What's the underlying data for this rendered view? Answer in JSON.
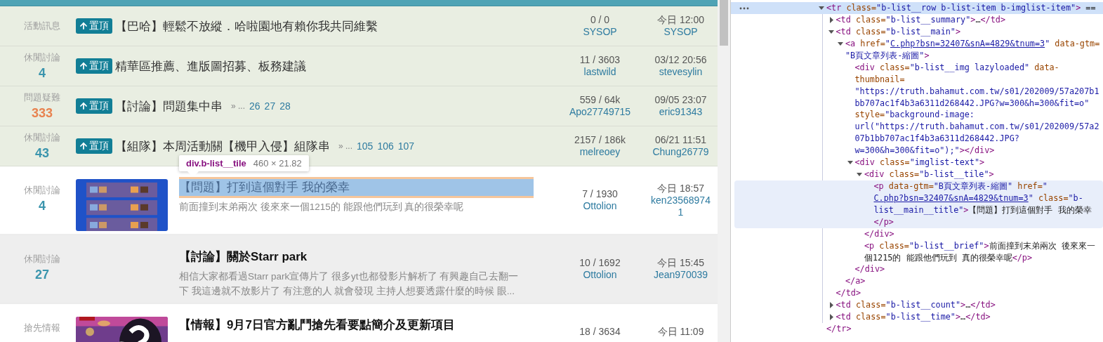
{
  "forum": {
    "rows": [
      {
        "kind": "pinned",
        "category": "活動訊息",
        "badge": "置頂",
        "title": "【巴哈】輕鬆不放縱．哈啦園地有賴你我共同維繫",
        "replies": "0 / 0",
        "author": "SYSOP",
        "time": "今日 12:00",
        "last_author": "SYSOP"
      },
      {
        "kind": "pinned",
        "category": "休閒討論",
        "count": "4",
        "color": "#3b95ad",
        "badge": "置頂",
        "title": "精華區推薦、進版圖招募、板務建議",
        "replies": "11 / 3603",
        "author": "lastwild",
        "time": "03/12 20:56",
        "last_author": "stevesylin"
      },
      {
        "kind": "pinned",
        "category": "問題疑難",
        "count": "333",
        "color": "#e8824f",
        "badge": "置頂",
        "title": "【討論】問題集中串",
        "page_prefix": "» ...",
        "pages": [
          "26",
          "27",
          "28"
        ],
        "replies": "559 / 64k",
        "author": "Apo27749715",
        "time": "09/05 23:07",
        "last_author": "eric91343"
      },
      {
        "kind": "pinned",
        "category": "休閒討論",
        "count": "43",
        "color": "#3b95ad",
        "badge": "置頂",
        "title": "【組隊】本周活動關【機甲入侵】組隊串",
        "page_prefix": "» ...",
        "pages": [
          "105",
          "106",
          "107"
        ],
        "replies": "2157 / 186k",
        "author": "melreoey",
        "time": "06/21 11:51",
        "last_author": "Chung26779"
      },
      {
        "kind": "normal",
        "shaded": false,
        "category": "休閒討論",
        "count": "4",
        "color": "#3b95ad",
        "thumbnail": {
          "kind": "picture",
          "video": false
        },
        "title": "【問題】打到這個對手 我的榮幸",
        "inspected": true,
        "inspect_tooltip": {
          "selector": "div.b-list__tile",
          "size": "460 × 21.82"
        },
        "brief": "前面撞到末弟兩次 後來來一個1215的 能跟他們玩到 真的很榮幸呢",
        "replies": "7 / 1930",
        "author": "Ottolion",
        "time": "今日 18:57",
        "last_author": "ken235689741"
      },
      {
        "kind": "normal",
        "shaded": true,
        "category": "休閒討論",
        "count": "27",
        "color": "#3b95ad",
        "title": "【討論】關於Starr park",
        "inspected": false,
        "brief": "相信大家都看過Starr park宣傳片了 很多yt也都發影片解析了 有興趣自己去翻一下 我這邊就不放影片了 有注意的人 就會發現 主持人想要透露什麼的時候 眼...",
        "replies": "10 / 1692",
        "author": "Ottolion",
        "time": "今日 15:45",
        "last_author": "Jean970039"
      },
      {
        "kind": "normal",
        "shaded": false,
        "category": "搶先情報",
        "thumbnail": {
          "kind": "picture",
          "video": true
        },
        "title": "【情報】9月7日官方亂鬥搶先看要點簡介及更新項目",
        "inspected": false,
        "replies": "18 / 3634",
        "time": "今日 11:09"
      }
    ]
  },
  "devtools": {
    "nodes": [
      {
        "selected": true,
        "hovered": false,
        "expanded": true,
        "open": [
          {
            "tag": "<tr"
          },
          {
            "attr": " class="
          },
          {
            "val": "\"b-list__row b-list-item b-imglist-item\""
          },
          {
            "tag": ">"
          },
          {
            "text": " =="
          }
        ],
        "close": [
          {
            "tag": "</tr>"
          }
        ],
        "children": [
          {
            "selected": false,
            "hovered": false,
            "expanded": false,
            "open": [
              {
                "tag": "<td"
              },
              {
                "attr": " class="
              },
              {
                "val": "\"b-list__summary\""
              },
              {
                "tag": ">"
              },
              {
                "text": "…"
              },
              {
                "tag": "</td>"
              }
            ]
          },
          {
            "selected": false,
            "hovered": false,
            "expanded": true,
            "open": [
              {
                "tag": "<td"
              },
              {
                "attr": " class="
              },
              {
                "val": "\"b-list__main\""
              },
              {
                "tag": ">"
              }
            ],
            "close": [
              {
                "tag": "</td>"
              }
            ],
            "children": [
              {
                "selected": false,
                "hovered": false,
                "expanded": true,
                "open": [
                  {
                    "tag": "<a"
                  },
                  {
                    "attr": " href="
                  },
                  {
                    "val": "\""
                  },
                  {
                    "link": "C.php?bsn=32407&snA=4829&tnum=3"
                  },
                  {
                    "val": "\""
                  },
                  {
                    "attr": " data-gtm="
                  },
                  {
                    "val": "\"B頁文章列表-縮圖\""
                  },
                  {
                    "tag": ">"
                  }
                ],
                "close": [
                  {
                    "tag": "</a>"
                  }
                ],
                "children": [
                  {
                    "selected": false,
                    "hovered": false,
                    "open": [
                      {
                        "tag": "<div"
                      },
                      {
                        "attr": " class="
                      },
                      {
                        "val": "\"b-list__img lazyloaded\""
                      },
                      {
                        "attr": " data-thumbnail="
                      },
                      {
                        "val": "\"https://truth.bahamut.com.tw/s01/202009/57a207b1bb707ac1f4b3a6311d268442.JPG?w=300&h=300&fit=o\""
                      },
                      {
                        "attr": " style="
                      },
                      {
                        "val": "\"background-image: url(\"https://truth.bahamut.com.tw/s01/202009/57a207b1bb707ac1f4b3a6311d268442.JPG?w=300&h=300&fit=o\");\""
                      },
                      {
                        "tag": "></div>"
                      }
                    ]
                  },
                  {
                    "selected": false,
                    "hovered": false,
                    "expanded": true,
                    "open": [
                      {
                        "tag": "<div"
                      },
                      {
                        "attr": " class="
                      },
                      {
                        "val": "\"imglist-text\""
                      },
                      {
                        "tag": ">"
                      }
                    ],
                    "close": [
                      {
                        "tag": "</div>"
                      }
                    ],
                    "children": [
                      {
                        "selected": false,
                        "hovered": false,
                        "expanded": true,
                        "open": [
                          {
                            "tag": "<div"
                          },
                          {
                            "attr": " class="
                          },
                          {
                            "val": "\"b-list__tile\""
                          },
                          {
                            "tag": ">"
                          }
                        ],
                        "close": [
                          {
                            "tag": "</div>"
                          }
                        ],
                        "children": [
                          {
                            "selected": false,
                            "hovered": true,
                            "open": [
                              {
                                "tag": "<p"
                              },
                              {
                                "attr": " data-gtm="
                              },
                              {
                                "val": "\"B頁文章列表-縮圖\""
                              },
                              {
                                "attr": " href="
                              },
                              {
                                "val": "\""
                              },
                              {
                                "link": "C.php?bsn=32407&snA=4829&tnum=3"
                              },
                              {
                                "val": "\""
                              },
                              {
                                "attr": " class="
                              },
                              {
                                "val": "\"b-list__main__title\""
                              },
                              {
                                "tag": ">"
                              },
                              {
                                "text": "【問題】打到這個對手 我的榮幸"
                              },
                              {
                                "tag": "</p>"
                              }
                            ]
                          }
                        ]
                      },
                      {
                        "selected": false,
                        "hovered": false,
                        "open": [
                          {
                            "tag": "<p"
                          },
                          {
                            "attr": " class="
                          },
                          {
                            "val": "\"b-list__brief\""
                          },
                          {
                            "tag": ">"
                          },
                          {
                            "text": "前面撞到末弟兩次 後來來一個1215的 能跟他們玩到 真的很榮幸呢"
                          },
                          {
                            "tag": "</p>"
                          }
                        ]
                      }
                    ]
                  }
                ]
              }
            ]
          },
          {
            "selected": false,
            "hovered": false,
            "expanded": false,
            "open": [
              {
                "tag": "<td"
              },
              {
                "attr": " class="
              },
              {
                "val": "\"b-list__count\""
              },
              {
                "tag": ">"
              },
              {
                "text": "…"
              },
              {
                "tag": "</td>"
              }
            ]
          },
          {
            "selected": false,
            "hovered": false,
            "expanded": false,
            "open": [
              {
                "tag": "<td"
              },
              {
                "attr": " class="
              },
              {
                "val": "\"b-list__time\""
              },
              {
                "tag": ">"
              },
              {
                "text": "…"
              },
              {
                "tag": "</td>"
              }
            ]
          }
        ]
      }
    ]
  }
}
